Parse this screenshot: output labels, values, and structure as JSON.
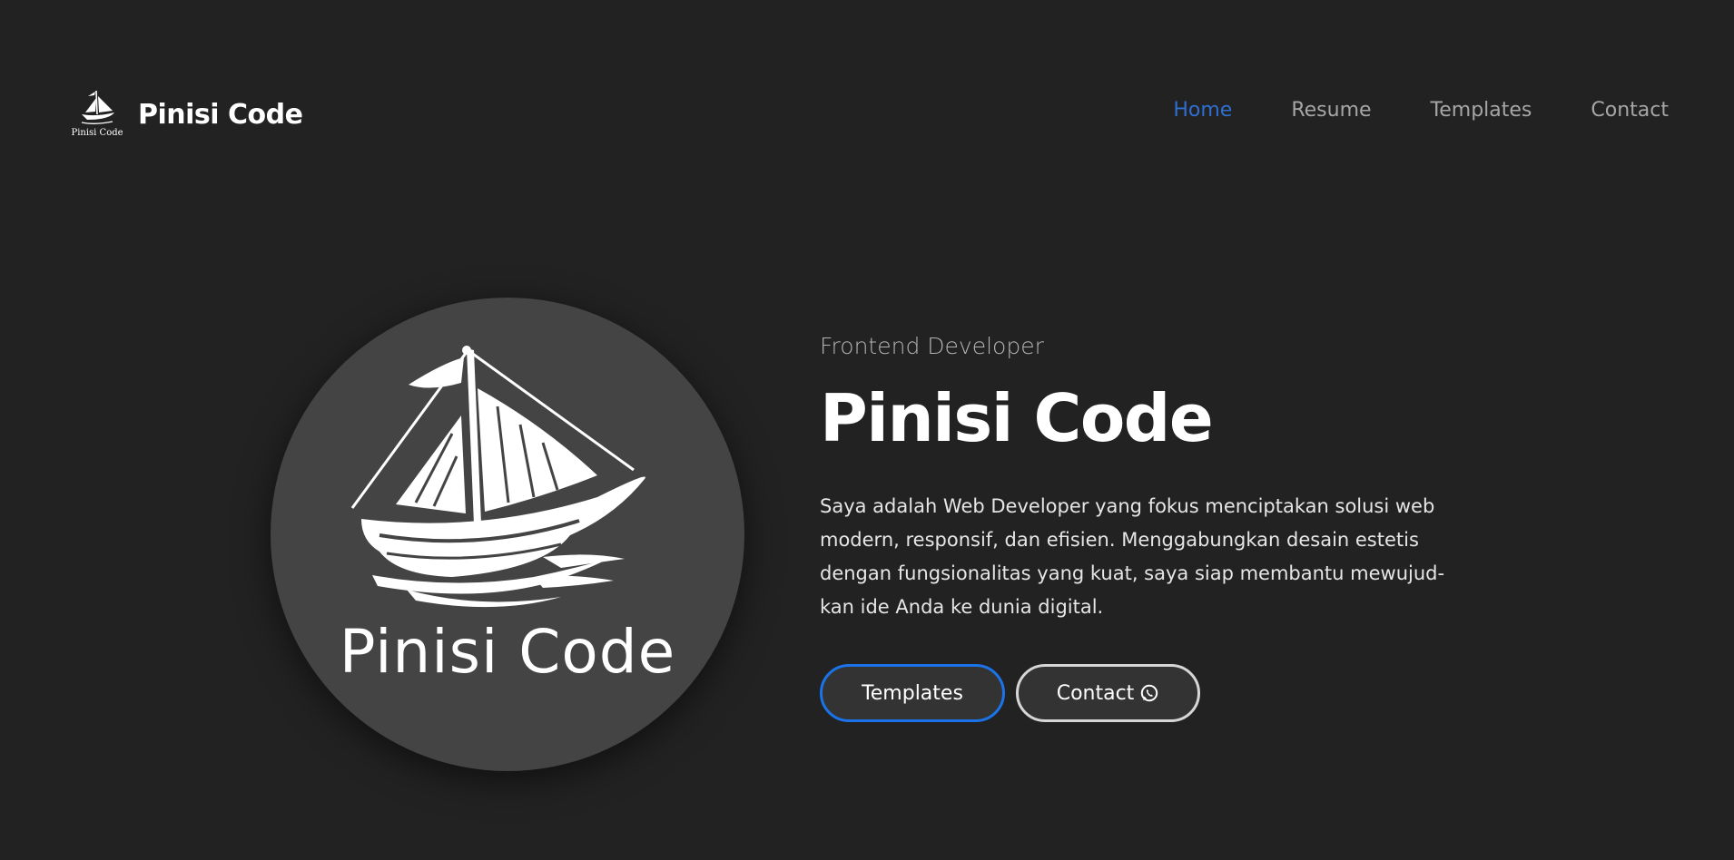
{
  "header": {
    "brand_name": "Pinisi Code",
    "brand_logo_caption": "Pinisi Code",
    "nav": [
      {
        "label": "Home",
        "active": true
      },
      {
        "label": "Resume",
        "active": false
      },
      {
        "label": "Templates",
        "active": false
      },
      {
        "label": "Contact",
        "active": false
      }
    ]
  },
  "hero": {
    "image_caption": "Pinisi Code",
    "subtitle": "Frontend Developer",
    "title": "Pinisi Code",
    "description": "Saya adalah Web Developer yang fokus menciptakan solusi web modern, responsif, dan efisien. Menggabungkan desain estetis dengan fungsionalitas yang kuat, saya siap membantu mewujud-kan ide Anda ke dunia digital.",
    "primary_button": "Templates",
    "secondary_button": "Contact",
    "secondary_button_icon": "whatsapp-icon"
  },
  "colors": {
    "background": "#222222",
    "accent": "#1a73e8",
    "nav_active": "#2e6fd1",
    "nav_inactive": "#a6a6a6",
    "logo_circle": "#444444"
  }
}
